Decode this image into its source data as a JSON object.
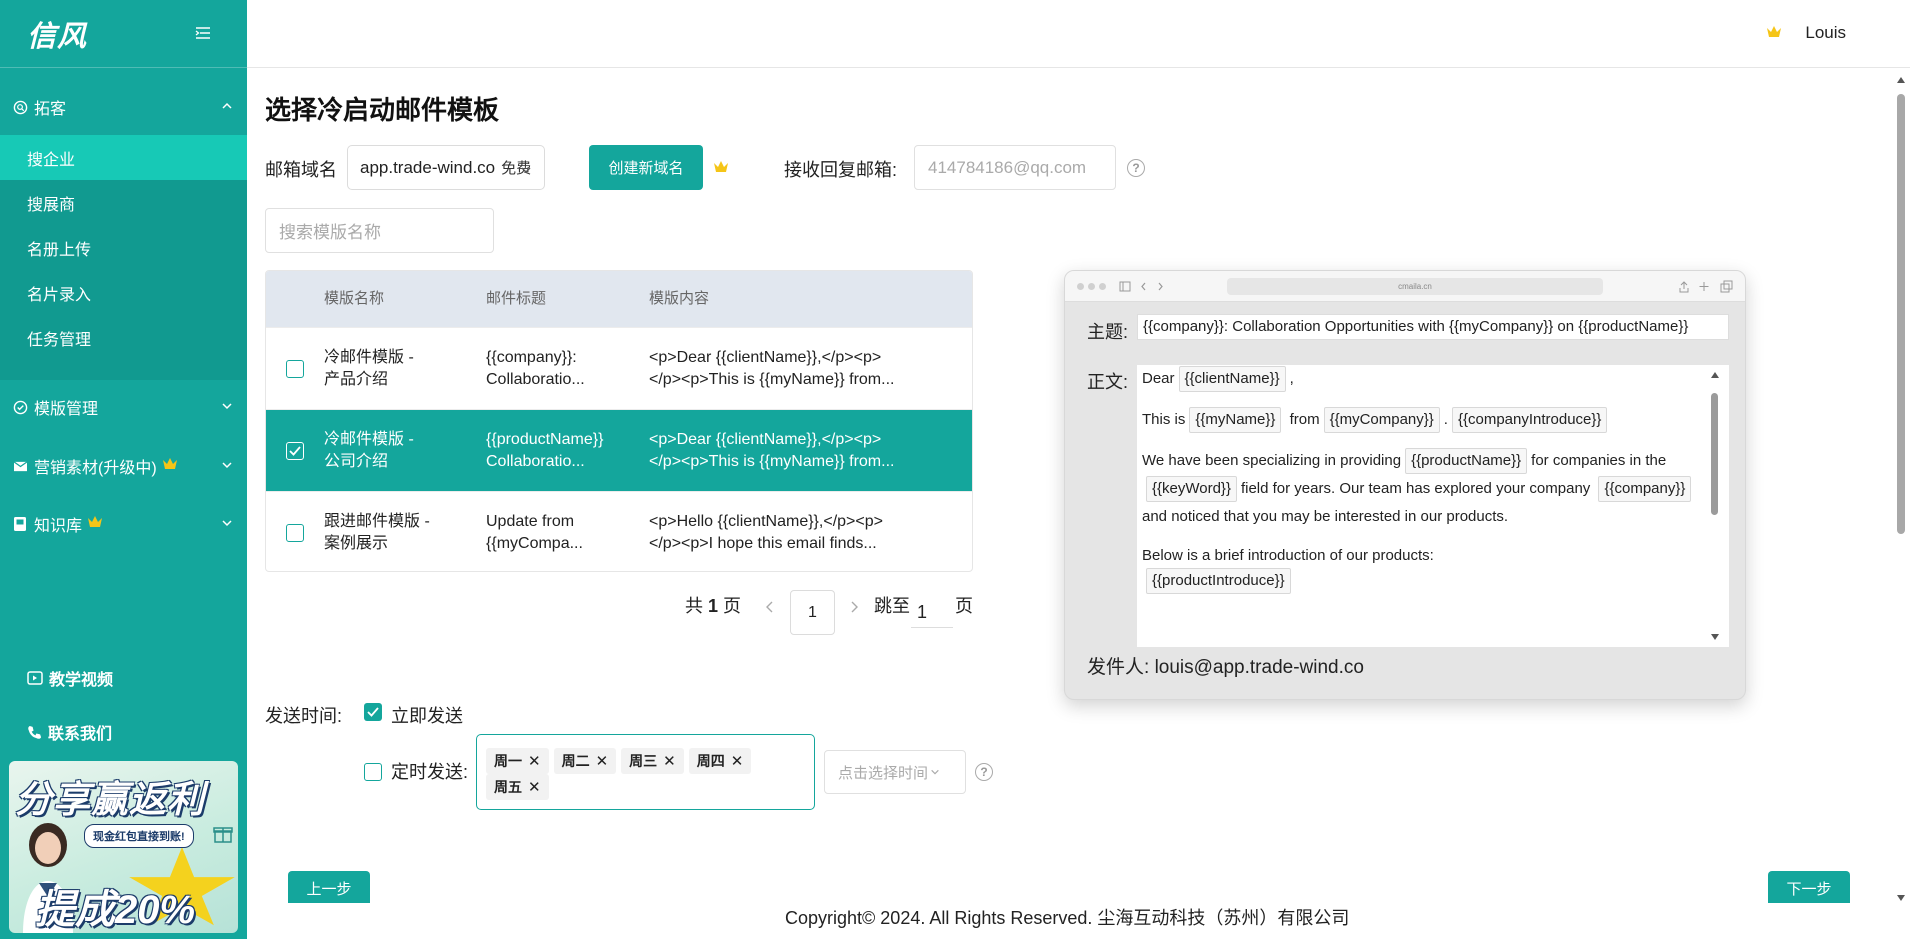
{
  "app": {
    "logo": "信风"
  },
  "header": {
    "user_name": "Louis"
  },
  "sidebar": {
    "groups": [
      {
        "label": "拓客",
        "items": [
          "搜企业",
          "搜展商",
          "名册上传",
          "名片录入",
          "任务管理"
        ]
      },
      {
        "label": "模版管理"
      },
      {
        "label": "营销素材(升级中)"
      },
      {
        "label": "知识库"
      }
    ],
    "links": [
      "教学视频",
      "联系我们"
    ],
    "banner": {
      "title": "分享赢返利",
      "subtitle": "现金红包直接到账!",
      "rate": "提成20%"
    }
  },
  "page": {
    "title": "选择冷启动邮件模板",
    "domain_label": "邮箱域名",
    "domain_value": "app.trade-wind.co",
    "domain_tag": "免费",
    "create_domain_btn": "创建新域名",
    "reply_label": "接收回复邮箱:",
    "reply_placeholder": "414784186@qq.com",
    "search_placeholder": "搜索模版名称"
  },
  "table": {
    "headers": [
      "模版名称",
      "邮件标题",
      "模版内容"
    ],
    "rows": [
      {
        "name1": "冷邮件模版 -",
        "name2": "产品介绍",
        "title1": "{{company}}:",
        "title2": "Collaboratio...",
        "content1": "<p>Dear {{clientName}},</p><p>",
        "content2": "</p><p>This is {{myName}} from...",
        "checked": false
      },
      {
        "name1": "冷邮件模版 -",
        "name2": "公司介绍",
        "title1": "{{productName}}",
        "title2": "Collaboratio...",
        "content1": "<p>Dear {{clientName}},</p><p>",
        "content2": "</p><p>This is {{myName}} from...",
        "checked": true
      },
      {
        "name1": "跟进邮件模版 -",
        "name2": "案例展示",
        "title1": "Update from",
        "title2": "{{myCompa...",
        "content1": "<p>Hello {{clientName}},</p><p>",
        "content2": "</p><p>I hope this email finds...",
        "checked": false
      }
    ]
  },
  "pagination": {
    "total_prefix": "共",
    "total_pages": "1",
    "total_suffix": "页",
    "current": "1",
    "jump_prefix": "跳至",
    "jump_value": "1",
    "jump_suffix": "页"
  },
  "send": {
    "label": "发送时间:",
    "immediate": "立即发送",
    "scheduled": "定时发送:",
    "days": [
      "周一",
      "周二",
      "周三",
      "周四",
      "周五"
    ],
    "time_placeholder": "点击选择时间"
  },
  "nav": {
    "prev": "上一步",
    "next": "下一步"
  },
  "footer": {
    "copyright": "Copyright© 2024. All Rights Reserved. 尘海互动科技（苏州）有限公司"
  },
  "preview": {
    "url": "cmaila.cn",
    "subject_label": "主题:",
    "subject": "{{company}}: Collaboration Opportunities with {{myCompany}} on {{productName}}",
    "body_label": "正文:",
    "greeting": "Dear",
    "ph_clientName": "{{clientName}}",
    "this_is": "This is",
    "ph_myName": "{{myName}}",
    "from": "from",
    "ph_myCompany": "{{myCompany}}",
    "ph_companyIntroduce": "{{companyIntroduce}}",
    "spec1": "We have been specializing in providing",
    "ph_productName": "{{productName}}",
    "spec2": "for companies in",
    "the": "the",
    "ph_keyWord": "{{keyWord}}",
    "spec3": "field for years. Our team has explored your company",
    "ph_company": "{{company}}",
    "spec4": "and noticed that you may be interested in our products.",
    "below": "Below is a brief introduction of our products:",
    "ph_productIntroduce": "{{productIntroduce}}",
    "sender_label": "发件人:",
    "sender": "louis@app.trade-wind.co"
  },
  "colors": {
    "accent": "#14a69c",
    "accent_light": "#17c9b6",
    "crown": "#f5c518"
  }
}
